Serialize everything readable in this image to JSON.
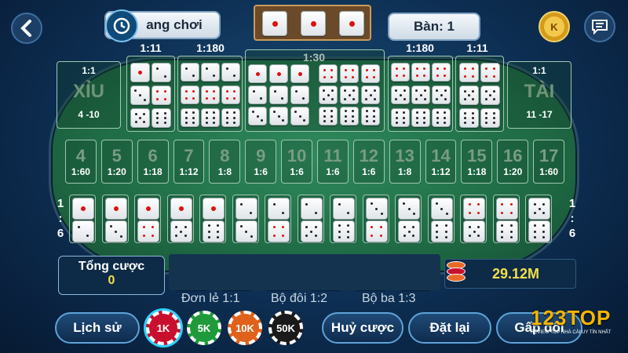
{
  "header": {
    "mode_label": "ang chơi",
    "table_label": "Bàn: 1",
    "coin_letter": "K",
    "dice_result": [
      1,
      1,
      1
    ]
  },
  "odds": {
    "triple_any": "1:11",
    "triple_spec": "1:180",
    "big_mid": "1:30",
    "triple_spec_r": "1:180",
    "triple_any_r": "1:11"
  },
  "small": {
    "odds": "1:1",
    "title": "XỈU",
    "range": "4 -10"
  },
  "big": {
    "odds": "1:1",
    "title": "TÀI",
    "range": "11 -17"
  },
  "sums": [
    {
      "n": "4",
      "o": "1:60"
    },
    {
      "n": "5",
      "o": "1:20"
    },
    {
      "n": "6",
      "o": "1:18"
    },
    {
      "n": "7",
      "o": "1:12"
    },
    {
      "n": "8",
      "o": "1:8"
    },
    {
      "n": "9",
      "o": "1:6"
    },
    {
      "n": "10",
      "o": "1:6"
    },
    {
      "n": "11",
      "o": "1:6"
    },
    {
      "n": "12",
      "o": "1:6"
    },
    {
      "n": "13",
      "o": "1:8"
    },
    {
      "n": "14",
      "o": "1:12"
    },
    {
      "n": "15",
      "o": "1:18"
    },
    {
      "n": "16",
      "o": "1:20"
    },
    {
      "n": "17",
      "o": "1:60"
    }
  ],
  "combo_odds": {
    "top": "1",
    "mid": ":",
    "bot": "6"
  },
  "total": {
    "label": "Tổng cược",
    "value": "0"
  },
  "balance": "29.12M",
  "payout_labels": {
    "single": "Đơn lẻ 1:1",
    "pair": "Bộ đôi 1:2",
    "triple": "Bộ ba 1:3"
  },
  "chips": [
    {
      "label": "1K",
      "color": "#c8102e"
    },
    {
      "label": "5K",
      "color": "#1f9a3a"
    },
    {
      "label": "10K",
      "color": "#e0611a"
    },
    {
      "label": "50K",
      "color": "#1a1a1a"
    }
  ],
  "buttons": {
    "history": "Lịch sử",
    "cancel": "Huỷ cược",
    "reset": "Đặt lại",
    "double": "Gấp đôi"
  },
  "watermark": {
    "brand": "123TOP",
    "tagline": "REVIEW TOP NHÀ CÁI UY TÍN NHẤT"
  },
  "colors": {
    "felt": "#1f6b45",
    "bg": "#0d2e52",
    "accent": "#5ea3d8",
    "gold": "#f2e04a"
  }
}
